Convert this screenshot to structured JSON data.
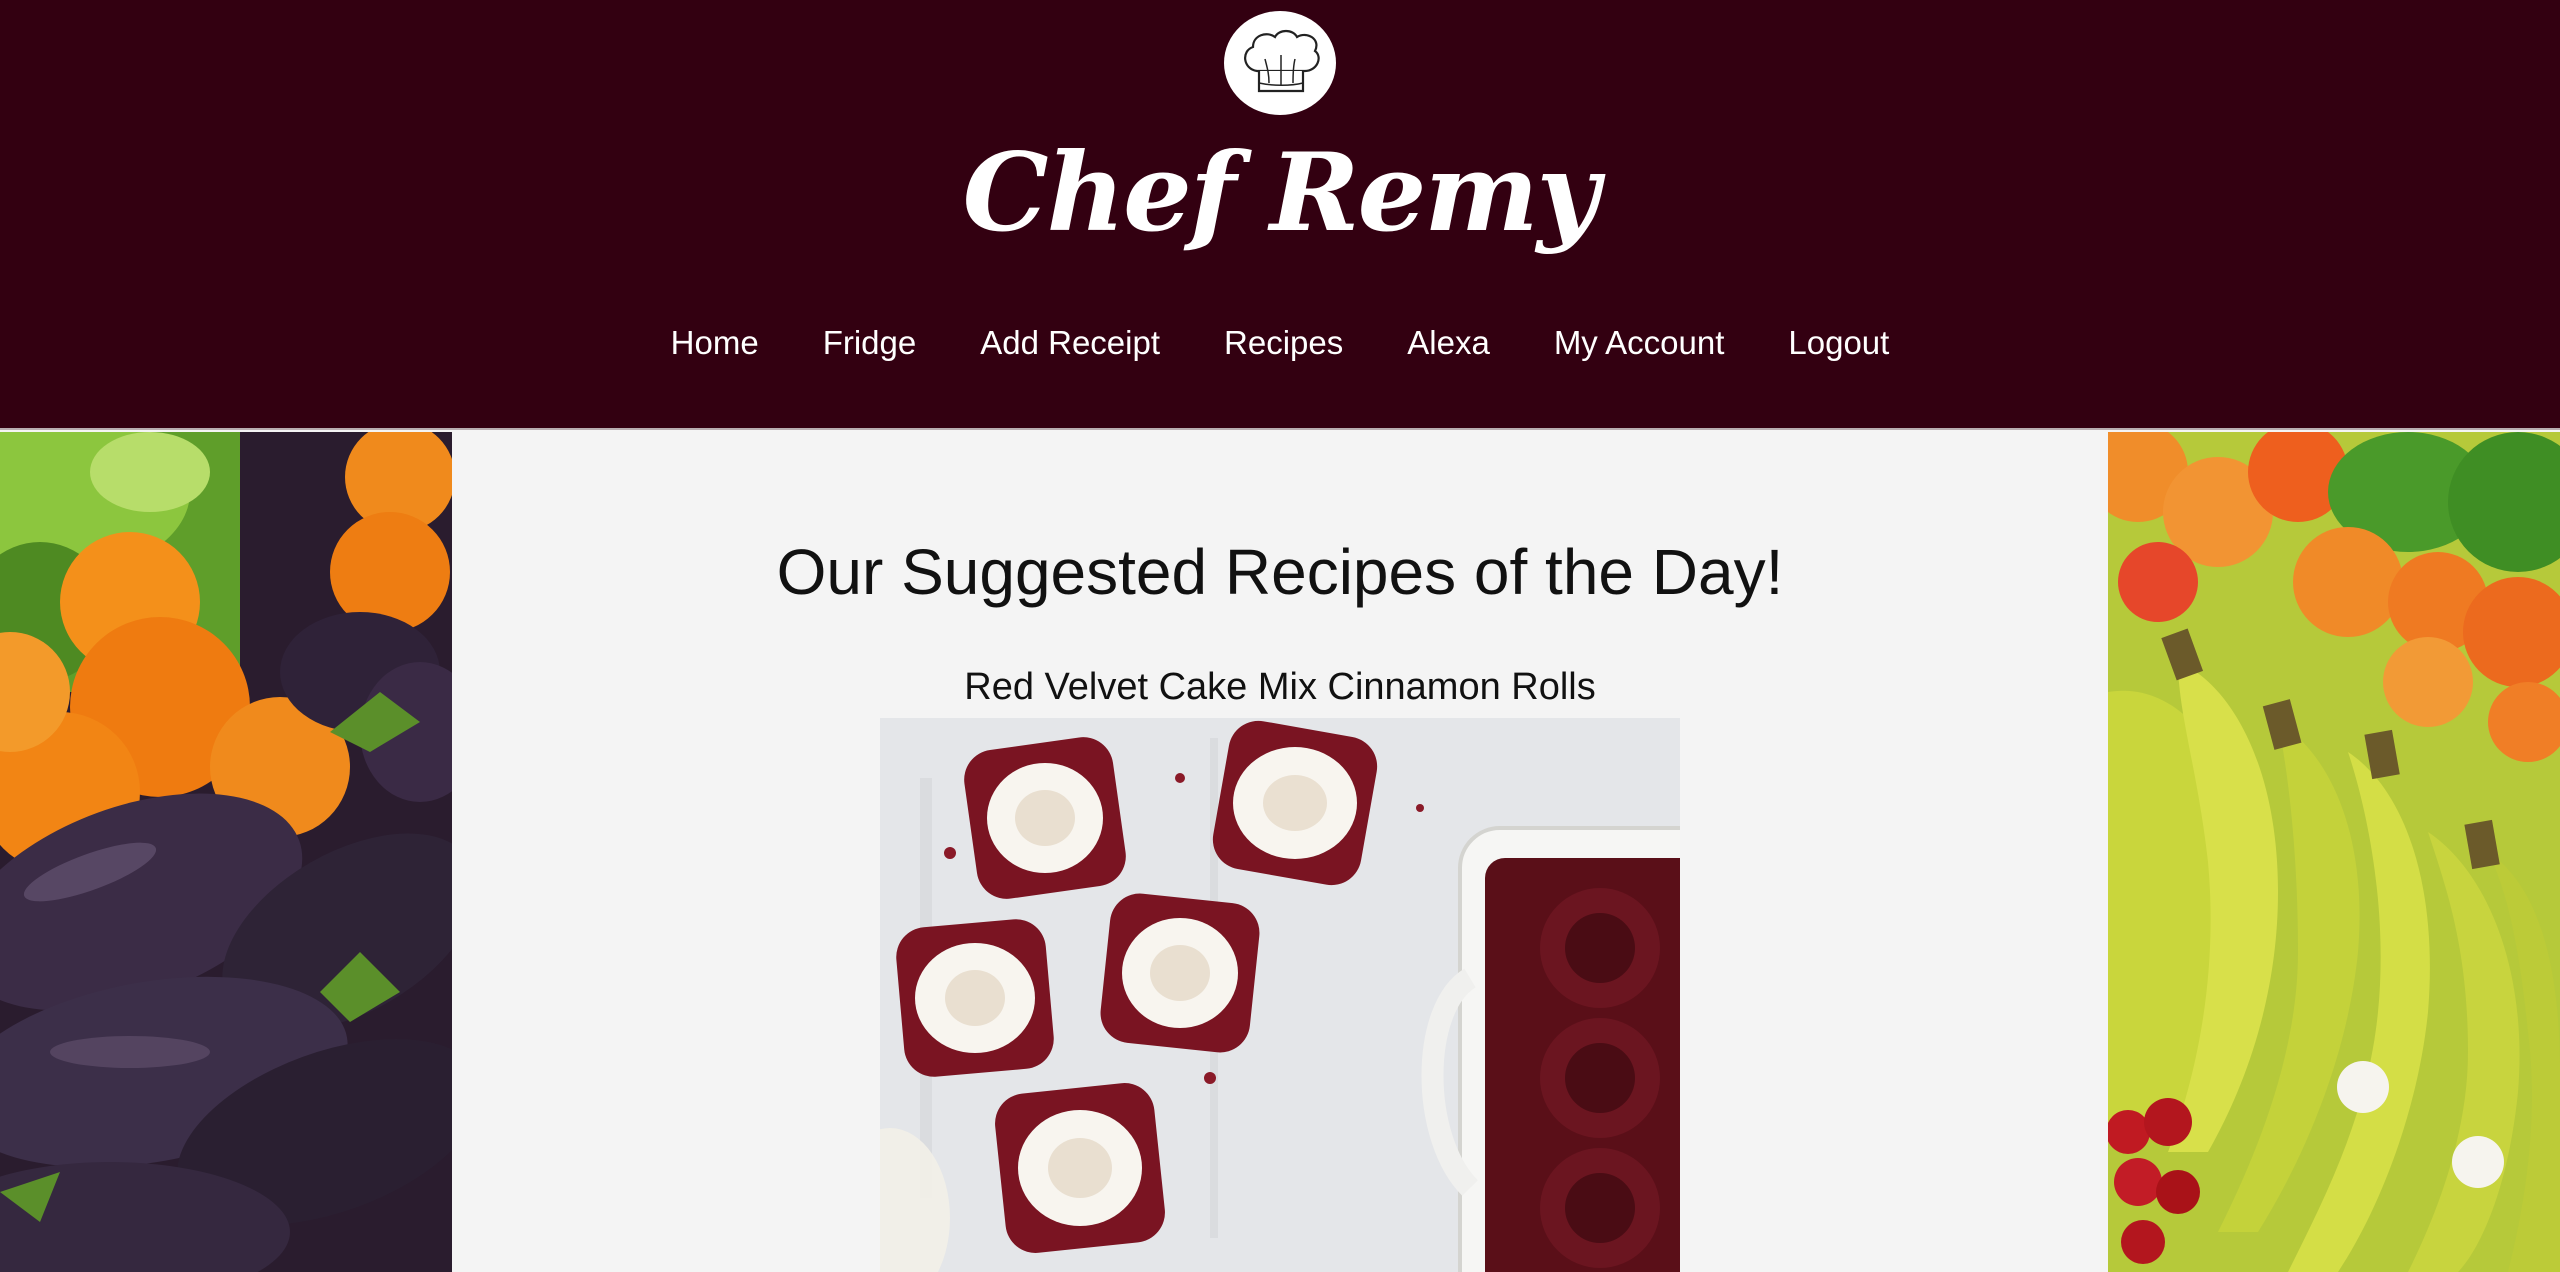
{
  "header": {
    "brand": "Chef Remy",
    "logo_icon": "chef-hat-icon",
    "background_color": "#330011"
  },
  "nav": {
    "items": [
      {
        "label": "Home"
      },
      {
        "label": "Fridge"
      },
      {
        "label": "Add Receipt"
      },
      {
        "label": "Recipes"
      },
      {
        "label": "Alexa"
      },
      {
        "label": "My Account"
      },
      {
        "label": "Logout"
      }
    ]
  },
  "main": {
    "title": "Our Suggested Recipes of the Day!",
    "recipe": {
      "title": "Red Velvet Cake Mix Cinnamon Rolls"
    }
  }
}
